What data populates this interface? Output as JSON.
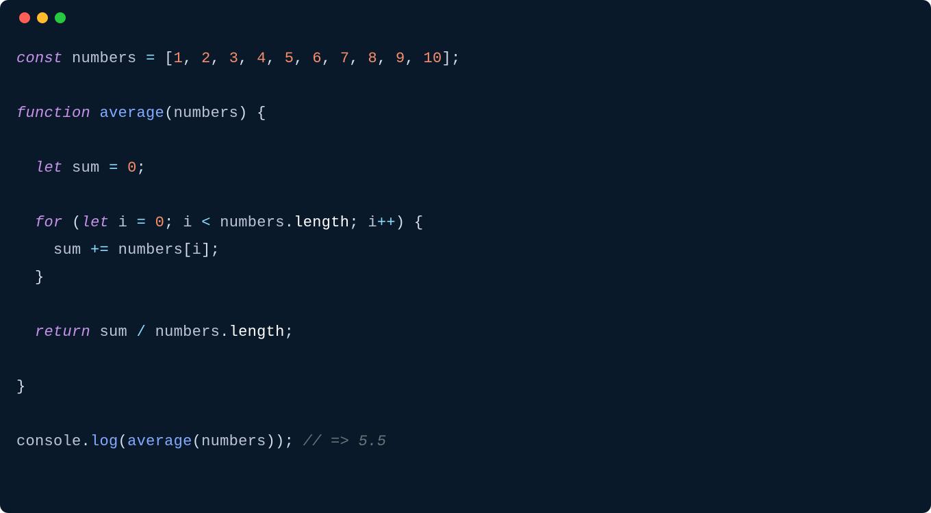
{
  "colors": {
    "background": "#0a1929",
    "traffic_red": "#ff5f56",
    "traffic_yellow": "#ffbd2e",
    "traffic_green": "#27c93f",
    "keyword": "#c792ea",
    "identifier": "#bcc4d6",
    "function": "#82aaff",
    "operator": "#89ddff",
    "punctuation": "#d6deeb",
    "number": "#f78c6c",
    "property": "#fefefe",
    "comment": "#637777"
  },
  "code": {
    "line1": {
      "kw_const": "const",
      "sp1": " ",
      "id_numbers": "numbers",
      "sp2": " ",
      "op_eq": "=",
      "sp3": " ",
      "lbracket": "[",
      "n1": "1",
      "c1": ",",
      "s1": " ",
      "n2": "2",
      "c2": ",",
      "s2": " ",
      "n3": "3",
      "c3": ",",
      "s3": " ",
      "n4": "4",
      "c4": ",",
      "s4": " ",
      "n5": "5",
      "c5": ",",
      "s5": " ",
      "n6": "6",
      "c6": ",",
      "s6": " ",
      "n7": "7",
      "c7": ",",
      "s7": " ",
      "n8": "8",
      "c8": ",",
      "s8": " ",
      "n9": "9",
      "c9": ",",
      "s9": " ",
      "n10": "10",
      "rbracket": "]",
      "semi": ";"
    },
    "line3": {
      "kw_function": "function",
      "sp1": " ",
      "fn_average": "average",
      "lparen": "(",
      "param": "numbers",
      "rparen": ")",
      "sp2": " ",
      "lbrace": "{"
    },
    "line5": {
      "indent": "  ",
      "kw_let": "let",
      "sp1": " ",
      "id_sum": "sum",
      "sp2": " ",
      "op_eq": "=",
      "sp3": " ",
      "zero": "0",
      "semi": ";"
    },
    "line7": {
      "indent": "  ",
      "kw_for": "for",
      "sp1": " ",
      "lparen": "(",
      "kw_let": "let",
      "sp2": " ",
      "id_i": "i",
      "sp3": " ",
      "op_eq": "=",
      "sp4": " ",
      "zero": "0",
      "semi1": ";",
      "sp5": " ",
      "id_i2": "i",
      "sp6": " ",
      "op_lt": "<",
      "sp7": " ",
      "id_numbers": "numbers",
      "dot": ".",
      "prop_length": "length",
      "semi2": ";",
      "sp8": " ",
      "id_i3": "i",
      "op_inc": "++",
      "rparen": ")",
      "sp9": " ",
      "lbrace": "{"
    },
    "line8": {
      "indent": "    ",
      "id_sum": "sum",
      "sp1": " ",
      "op_pluseq": "+=",
      "sp2": " ",
      "id_numbers": "numbers",
      "lbracket": "[",
      "id_i": "i",
      "rbracket": "]",
      "semi": ";"
    },
    "line9": {
      "indent": "  ",
      "rbrace": "}"
    },
    "line11": {
      "indent": "  ",
      "kw_return": "return",
      "sp1": " ",
      "id_sum": "sum",
      "sp2": " ",
      "op_div": "/",
      "sp3": " ",
      "id_numbers": "numbers",
      "dot": ".",
      "prop_length": "length",
      "semi": ";"
    },
    "line13": {
      "rbrace": "}"
    },
    "line15": {
      "id_console": "console",
      "dot": ".",
      "fn_log": "log",
      "lparen": "(",
      "fn_average": "average",
      "lparen2": "(",
      "id_numbers": "numbers",
      "rparen2": ")",
      "rparen": ")",
      "semi": ";",
      "sp": " ",
      "comment": "// => 5.5"
    }
  }
}
